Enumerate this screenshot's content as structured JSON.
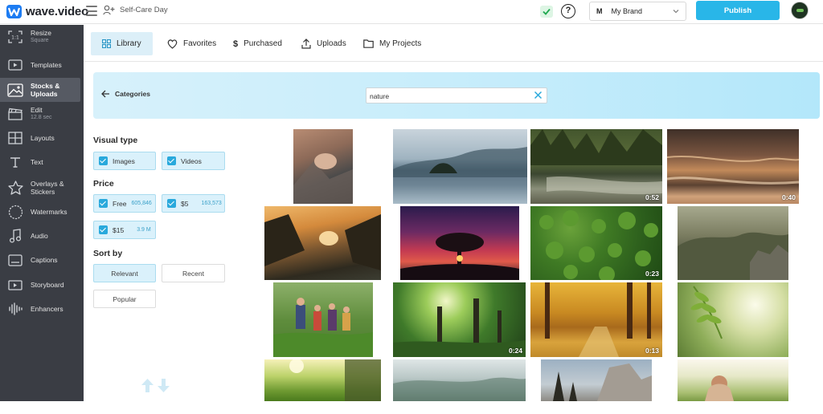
{
  "app": {
    "name": "wave.video",
    "project_name": "Self-Care Day",
    "brand": "My Brand",
    "brand_initial": "M",
    "help_label": "?",
    "publish_label": "Publish"
  },
  "sidebar": {
    "items": [
      {
        "label": "Resize",
        "sub": "Square",
        "icon": "resize-icon"
      },
      {
        "label": "Templates",
        "icon": "templates-icon"
      },
      {
        "label": "Stocks & Uploads",
        "icon": "image-icon"
      },
      {
        "label": "Edit",
        "sub": "12.8 sec",
        "icon": "clapper-icon"
      },
      {
        "label": "Layouts",
        "icon": "layouts-icon"
      },
      {
        "label": "Text",
        "icon": "text-icon"
      },
      {
        "label": "Overlays & Stickers",
        "icon": "star-icon"
      },
      {
        "label": "Watermarks",
        "icon": "watermark-icon"
      },
      {
        "label": "Audio",
        "icon": "music-icon"
      },
      {
        "label": "Captions",
        "icon": "captions-icon"
      },
      {
        "label": "Storyboard",
        "icon": "storyboard-icon"
      },
      {
        "label": "Enhancers",
        "icon": "waveform-icon"
      }
    ]
  },
  "tabs": [
    {
      "label": "Library",
      "icon": "grid-icon"
    },
    {
      "label": "Favorites",
      "icon": "heart-icon"
    },
    {
      "label": "Purchased",
      "icon": "dollar-icon"
    },
    {
      "label": "Uploads",
      "icon": "upload-icon"
    },
    {
      "label": "My Projects",
      "icon": "folder-icon"
    }
  ],
  "search": {
    "back_label": "Categories",
    "value": "nature"
  },
  "filters": {
    "visual_type_title": "Visual type",
    "visual_types": [
      {
        "label": "Images",
        "checked": true
      },
      {
        "label": "Videos",
        "checked": true
      }
    ],
    "price_title": "Price",
    "prices": [
      {
        "label": "Free",
        "count": "605,846",
        "checked": true
      },
      {
        "label": "$5",
        "count": "163,573",
        "checked": true
      },
      {
        "label": "$15",
        "count": "3.9 M",
        "checked": true
      }
    ],
    "sort_title": "Sort by",
    "sort_options": [
      {
        "label": "Relevant",
        "selected": true
      },
      {
        "label": "Recent",
        "selected": false
      },
      {
        "label": "Popular",
        "selected": false
      }
    ]
  },
  "media": [
    {
      "desc": "friends-sitting-on-rocks",
      "duration": ""
    },
    {
      "desc": "misty-lake-island",
      "duration": ""
    },
    {
      "desc": "forest-river",
      "duration": "0:52"
    },
    {
      "desc": "ocean-waves-sunset",
      "duration": "0:40"
    },
    {
      "desc": "sunset-mountain-lake",
      "duration": ""
    },
    {
      "desc": "tree-red-sky",
      "duration": ""
    },
    {
      "desc": "forest-aerial-top",
      "duration": "0:23"
    },
    {
      "desc": "misty-rocky-hills",
      "duration": ""
    },
    {
      "desc": "family-hiking",
      "duration": ""
    },
    {
      "desc": "sunlit-jungle",
      "duration": "0:24"
    },
    {
      "desc": "autumn-forest-path",
      "duration": "0:13"
    },
    {
      "desc": "fern-leaves-sunlight",
      "duration": ""
    },
    {
      "desc": "sunny-meadow-tree",
      "duration": ""
    },
    {
      "desc": "foggy-valley",
      "duration": ""
    },
    {
      "desc": "rock-cliff-pines",
      "duration": ""
    },
    {
      "desc": "woman-in-grass",
      "duration": ""
    }
  ]
}
